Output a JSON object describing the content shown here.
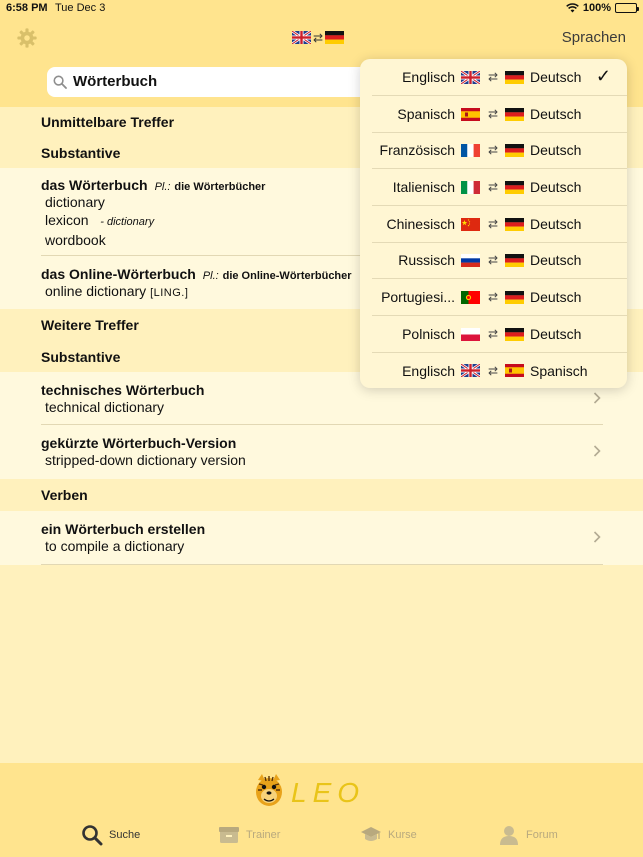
{
  "status": {
    "time": "6:58 PM",
    "date": "Tue Dec 3",
    "battery": "100%"
  },
  "nav": {
    "sprachen_label": "Sprachen",
    "arrows": "⇄"
  },
  "search": {
    "value": "Wörterbuch"
  },
  "sections": {
    "direct": "Unmittelbare Treffer",
    "nouns1": "Substantive",
    "more": "Weitere Treffer",
    "nouns2": "Substantive",
    "verbs": "Verben"
  },
  "entries": [
    {
      "term": "das Wörterbuch",
      "pl_label": "Pl.:",
      "pl_value": "die Wörterbücher",
      "t1": "dictionary",
      "t2": "lexicon",
      "t2_tag": "- dictionary",
      "t3": "wordbook"
    },
    {
      "term": "das Online-Wörterbuch",
      "pl_label": "Pl.:",
      "pl_value": "die Online-Wörterbücher",
      "t1": "online dictionary",
      "t1_tag": "[LING.]"
    },
    {
      "term": "technisches Wörterbuch",
      "t1": "technical dictionary"
    },
    {
      "term": "gekürzte Wörterbuch-Version",
      "t1": "stripped-down dictionary version"
    },
    {
      "term": "ein Wörterbuch erstellen",
      "t1": "to compile a dictionary"
    }
  ],
  "languages": [
    {
      "src": "Englisch",
      "src_flag": "uk",
      "tgt": "Deutsch",
      "tgt_flag": "de",
      "selected": true
    },
    {
      "src": "Spanisch",
      "src_flag": "es",
      "tgt": "Deutsch",
      "tgt_flag": "de"
    },
    {
      "src": "Französisch",
      "src_flag": "fr",
      "tgt": "Deutsch",
      "tgt_flag": "de"
    },
    {
      "src": "Italienisch",
      "src_flag": "it",
      "tgt": "Deutsch",
      "tgt_flag": "de"
    },
    {
      "src": "Chinesisch",
      "src_flag": "cn",
      "tgt": "Deutsch",
      "tgt_flag": "de"
    },
    {
      "src": "Russisch",
      "src_flag": "ru",
      "tgt": "Deutsch",
      "tgt_flag": "de"
    },
    {
      "src": "Portugiesi...",
      "src_flag": "pt",
      "tgt": "Deutsch",
      "tgt_flag": "de"
    },
    {
      "src": "Polnisch",
      "src_flag": "pl",
      "tgt": "Deutsch",
      "tgt_flag": "de"
    },
    {
      "src": "Englisch",
      "src_flag": "uk",
      "tgt": "Spanisch",
      "tgt_flag": "es"
    }
  ],
  "check_mark": "✓",
  "logo_text": "LEO",
  "tabs": [
    {
      "label": "Suche",
      "icon": "search-icon",
      "active": true
    },
    {
      "label": "Trainer",
      "icon": "box-icon"
    },
    {
      "label": "Kurse",
      "icon": "graduation-cap-icon"
    },
    {
      "label": "Forum",
      "icon": "person-icon"
    }
  ],
  "colors": {
    "bar": "#ffe48e",
    "background": "#fff1bd",
    "row": "#fff9dd",
    "inactive_tab": "#b8a97e"
  }
}
